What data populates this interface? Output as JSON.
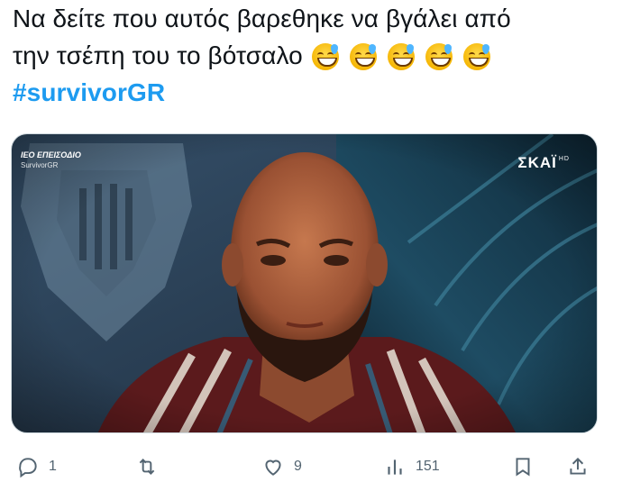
{
  "tweet": {
    "line1": "Να δείτε που αυτός βαρεθηκε να βγάλει από",
    "line2": "την τσέπη του το βότσαλο",
    "emojis": [
      "grinning-face-with-sweat",
      "grinning-face-with-sweat",
      "grinning-face-with-sweat",
      "grinning-face-with-sweat",
      "grinning-face-with-sweat"
    ],
    "hashtag": "#survivorGR"
  },
  "media": {
    "overlay_title": "ΙΕΟ ΕΠΕΙΣΟΔΙΟ",
    "overlay_subtitle": "SurvivorGR",
    "channel": "ΣΚΑΪ",
    "channel_hd": "HD"
  },
  "actions": {
    "reply_count": "1",
    "retweet_count": "",
    "like_count": "9",
    "views_count": "151"
  },
  "colors": {
    "link": "#1d9bf0",
    "text": "#0f1419",
    "muted": "#536471"
  }
}
